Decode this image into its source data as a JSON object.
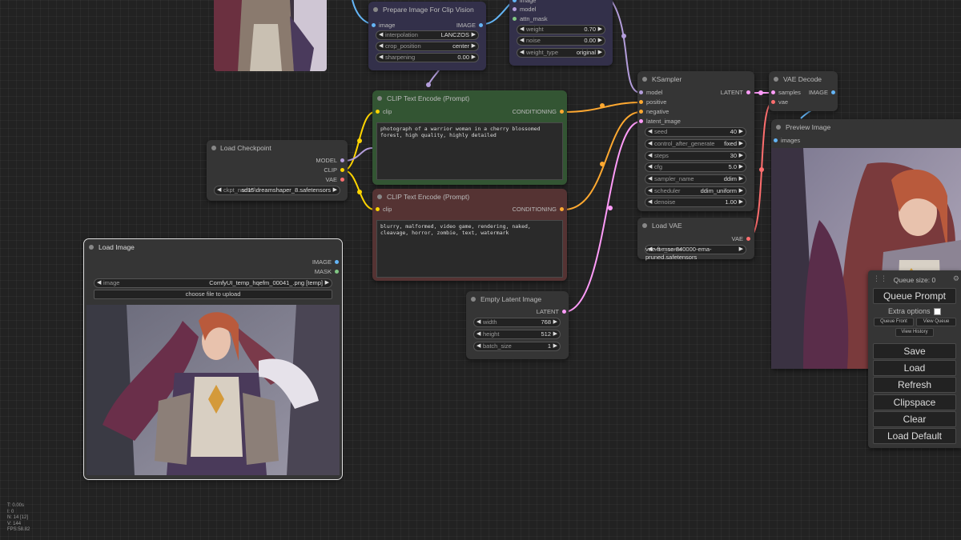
{
  "nodes": {
    "prepare_image": {
      "title": "Prepare Image For Clip Vision",
      "input": "image",
      "output": "IMAGE",
      "widgets": [
        {
          "label": "interpolation",
          "value": "LANCZOS"
        },
        {
          "label": "crop_position",
          "value": "center"
        },
        {
          "label": "sharpening",
          "value": "0.00"
        }
      ]
    },
    "ipadapter": {
      "inputs": [
        "image",
        "model",
        "attn_mask"
      ],
      "widgets": [
        {
          "label": "weight",
          "value": "0.70"
        },
        {
          "label": "noise",
          "value": "0.00"
        },
        {
          "label": "weight_type",
          "value": "original"
        }
      ]
    },
    "clip_pos": {
      "title": "CLIP Text Encode (Prompt)",
      "input": "clip",
      "output": "CONDITIONING",
      "text": "photograph of a warrior woman in a cherry blossomed forest, high quality, highly detailed"
    },
    "clip_neg": {
      "title": "CLIP Text Encode (Prompt)",
      "input": "clip",
      "output": "CONDITIONING",
      "text": "blurry, malformed, video game, rendering, naked, cleavage, horror, zombie, text, watermark"
    },
    "checkpoint": {
      "title": "Load Checkpoint",
      "outputs": [
        "MODEL",
        "CLIP",
        "VAE"
      ],
      "widget": {
        "label": "ckpt_name",
        "value": "sd15\\dreamshaper_8.safetensors"
      }
    },
    "ksampler": {
      "title": "KSampler",
      "inputs": [
        "model",
        "positive",
        "negative",
        "latent_image"
      ],
      "output": "LATENT",
      "widgets": [
        {
          "label": "seed",
          "value": "40"
        },
        {
          "label": "control_after_generate",
          "value": "fixed"
        },
        {
          "label": "steps",
          "value": "30"
        },
        {
          "label": "cfg",
          "value": "5.0"
        },
        {
          "label": "sampler_name",
          "value": "ddim"
        },
        {
          "label": "scheduler",
          "value": "ddim_uniform"
        },
        {
          "label": "denoise",
          "value": "1.00"
        }
      ]
    },
    "vae_decode": {
      "title": "VAE Decode",
      "inputs": [
        "samples",
        "vae"
      ],
      "output": "IMAGE"
    },
    "preview": {
      "title": "Preview Image",
      "input": "images"
    },
    "load_vae": {
      "title": "Load VAE",
      "output": "VAE",
      "widget": {
        "label": "vae_name",
        "value": "vae-ft-mse-840000-ema-pruned.safetensors"
      }
    },
    "load_image": {
      "title": "Load Image",
      "outputs": [
        "IMAGE",
        "MASK"
      ],
      "widget": {
        "label": "image",
        "value": "ComfyUI_temp_hqefm_00041_.png [temp]"
      },
      "upload_label": "choose file to upload"
    },
    "empty_latent": {
      "title": "Empty Latent Image",
      "output": "LATENT",
      "widgets": [
        {
          "label": "width",
          "value": "768"
        },
        {
          "label": "height",
          "value": "512"
        },
        {
          "label": "batch_size",
          "value": "1"
        }
      ]
    }
  },
  "menu": {
    "queue_size": "Queue size: 0",
    "queue_prompt": "Queue Prompt",
    "extra_options": "Extra options",
    "queue_front": "Queue Front",
    "view_queue": "View Queue",
    "view_history": "View History",
    "save": "Save",
    "load": "Load",
    "refresh": "Refresh",
    "clipspace": "Clipspace",
    "clear": "Clear",
    "load_default": "Load Default"
  },
  "stats": [
    "T: 0.00s",
    "I: 0",
    "N: 14 [12]",
    "V: 144",
    "FPS:58.82"
  ],
  "colors": {
    "clip": "#ffd500",
    "conditioning": "#ffa931",
    "latent": "#ff9cf9",
    "vae": "#ff6e6e",
    "image": "#64b5f6",
    "model": "#b39ddb",
    "mask": "#81c784"
  },
  "icons": {
    "gear": "gear-icon",
    "drag": "drag-handle-icon",
    "left": "arrow-left-icon",
    "right": "arrow-right-icon"
  }
}
